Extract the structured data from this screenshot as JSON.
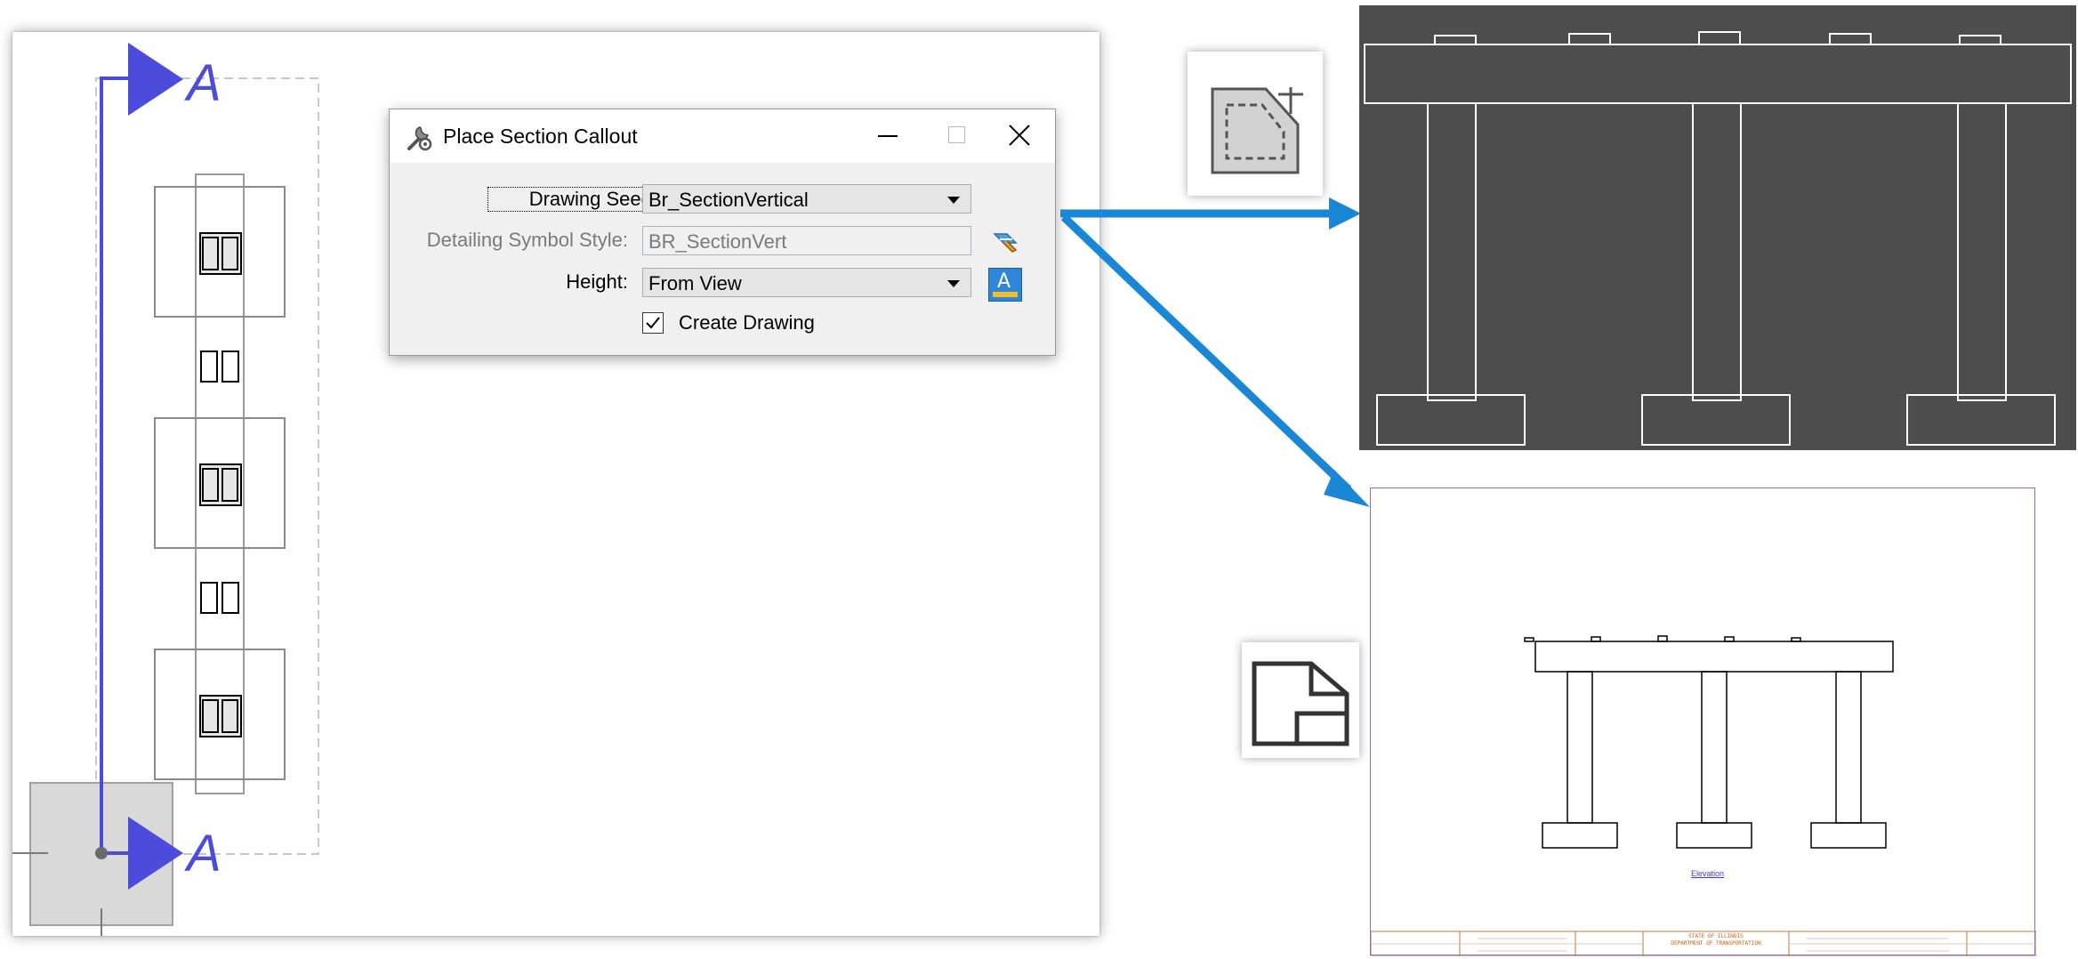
{
  "plan": {
    "section_marker_letter": "A"
  },
  "dialog": {
    "title": "Place Section Callout",
    "drawing_seed_label": "Drawing Seed:",
    "drawing_seed_value": "Br_SectionVertical",
    "detailing_symbol_style_label": "Detailing Symbol Style:",
    "detailing_symbol_style_value": "BR_SectionVert",
    "height_label": "Height:",
    "height_value": "From View",
    "create_drawing_label": "Create Drawing",
    "create_drawing_checked": true
  },
  "drawing_sheet": {
    "view_label": "Elevation",
    "title_block_line1": "STATE OF ILLINOIS",
    "title_block_line2": "DEPARTMENT OF TRANSPORTATION"
  },
  "colors": {
    "section_line": "#4b4bdc",
    "arrow": "#1a86d6",
    "section_view_bg": "#4d4d4d",
    "sheet_border": "#8b6ad6",
    "title_block_text": "#d06010",
    "elevation_link": "#3a3ad8"
  },
  "icons": {
    "dialog_icon": "tool-settings-icon",
    "callout_tool": "section-callout-tool-icon",
    "drawing_tool": "drawing-sheet-tool-icon",
    "style_picker": "eyedropper-icon",
    "text_style": "text-style-icon"
  }
}
